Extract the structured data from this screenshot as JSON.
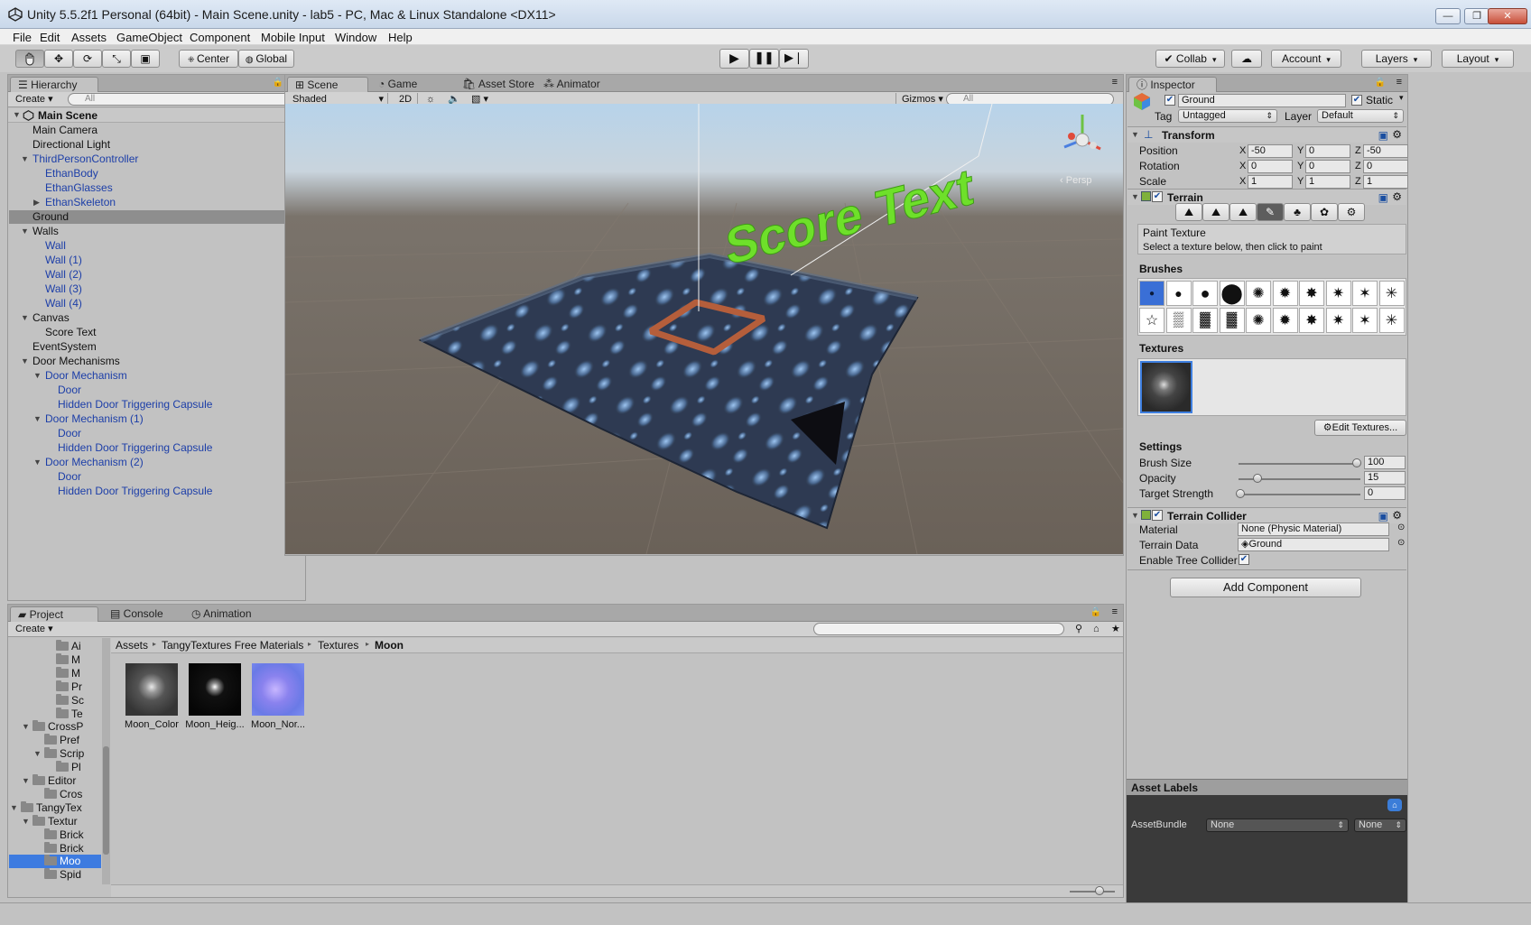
{
  "window": {
    "title": "Unity 5.5.2f1 Personal (64bit) - Main Scene.unity - lab5 - PC, Mac & Linux Standalone <DX11>",
    "min": "—",
    "max": "❐",
    "close": "✕"
  },
  "menu": [
    "File",
    "Edit",
    "Assets",
    "GameObject",
    "Component",
    "Mobile Input",
    "Window",
    "Help"
  ],
  "toolbar": {
    "pivot": "Center",
    "space": "Global",
    "collab": "Collab",
    "account": "Account",
    "layers": "Layers",
    "layout": "Layout"
  },
  "hierarchy": {
    "tab": "Hierarchy",
    "create": "Create",
    "search_placeholder": "All",
    "scene": "Main Scene",
    "items": [
      {
        "label": "Main Camera",
        "indent": 0,
        "blue": false
      },
      {
        "label": "Directional Light",
        "indent": 0,
        "blue": false
      },
      {
        "label": "ThirdPersonController",
        "indent": 0,
        "blue": true,
        "expanded": true
      },
      {
        "label": "EthanBody",
        "indent": 1,
        "blue": true
      },
      {
        "label": "EthanGlasses",
        "indent": 1,
        "blue": true
      },
      {
        "label": "EthanSkeleton",
        "indent": 1,
        "blue": true,
        "collapsed": true
      },
      {
        "label": "Ground",
        "indent": 0,
        "blue": false,
        "selected": true
      },
      {
        "label": "Walls",
        "indent": 0,
        "blue": false,
        "expanded": true
      },
      {
        "label": "Wall",
        "indent": 1,
        "blue": true
      },
      {
        "label": "Wall (1)",
        "indent": 1,
        "blue": true
      },
      {
        "label": "Wall (2)",
        "indent": 1,
        "blue": true
      },
      {
        "label": "Wall (3)",
        "indent": 1,
        "blue": true
      },
      {
        "label": "Wall (4)",
        "indent": 1,
        "blue": true
      },
      {
        "label": "Canvas",
        "indent": 0,
        "blue": false,
        "expanded": true
      },
      {
        "label": "Score Text",
        "indent": 1,
        "blue": false
      },
      {
        "label": "EventSystem",
        "indent": 0,
        "blue": false
      },
      {
        "label": "Door Mechanisms",
        "indent": 0,
        "blue": false,
        "expanded": true
      },
      {
        "label": "Door Mechanism",
        "indent": 1,
        "blue": true,
        "expanded": true
      },
      {
        "label": "Door",
        "indent": 2,
        "blue": true
      },
      {
        "label": "Hidden Door Triggering Capsule",
        "indent": 2,
        "blue": true
      },
      {
        "label": "Door Mechanism (1)",
        "indent": 1,
        "blue": true,
        "expanded": true
      },
      {
        "label": "Door",
        "indent": 2,
        "blue": true
      },
      {
        "label": "Hidden Door Triggering Capsule",
        "indent": 2,
        "blue": true
      },
      {
        "label": "Door Mechanism (2)",
        "indent": 1,
        "blue": true,
        "expanded": true
      },
      {
        "label": "Door",
        "indent": 2,
        "blue": true
      },
      {
        "label": "Hidden Door Triggering Capsule",
        "indent": 2,
        "blue": true
      }
    ]
  },
  "scene": {
    "tabs": [
      "Scene",
      "Game",
      "Asset Store",
      "Animator"
    ],
    "shading": "Shaded",
    "mode2d": "2D",
    "gizmos": "Gizmos",
    "search_placeholder": "All",
    "persp": "Persp",
    "score_text": "Score Text"
  },
  "inspector": {
    "tab": "Inspector",
    "object_name": "Ground",
    "static": "Static",
    "tag_label": "Tag",
    "tag": "Untagged",
    "layer_label": "Layer",
    "layer": "Default",
    "transform": {
      "title": "Transform",
      "position_label": "Position",
      "rotation_label": "Rotation",
      "scale_label": "Scale",
      "position": [
        "-50",
        "0",
        "-50"
      ],
      "rotation": [
        "0",
        "0",
        "0"
      ],
      "scale": [
        "1",
        "1",
        "1"
      ]
    },
    "terrain": {
      "title": "Terrain",
      "tool_title": "Paint Texture",
      "tool_hint": "Select a texture below, then click to paint",
      "brushes_label": "Brushes",
      "textures_label": "Textures",
      "edit_textures": "Edit Textures...",
      "settings_label": "Settings",
      "brush_size_label": "Brush Size",
      "brush_size": "100",
      "opacity_label": "Opacity",
      "opacity": "15",
      "target_strength_label": "Target Strength",
      "target_strength": "0"
    },
    "collider": {
      "title": "Terrain Collider",
      "material_label": "Material",
      "material": "None (Physic Material)",
      "data_label": "Terrain Data",
      "data": "Ground",
      "tree_label": "Enable Tree Collider"
    },
    "add_component": "Add Component",
    "asset_labels": "Asset Labels",
    "asset_bundle": "AssetBundle",
    "bundle_none": "None",
    "variant_none": "None"
  },
  "project": {
    "tabs": [
      "Project",
      "Console",
      "Animation"
    ],
    "create": "Create",
    "breadcrumb": [
      "Assets",
      "TangyTextures Free Materials",
      "Textures",
      "Moon"
    ],
    "tree": [
      {
        "label": "Ai",
        "indent": 3
      },
      {
        "label": "M",
        "indent": 3
      },
      {
        "label": "M",
        "indent": 3
      },
      {
        "label": "Pr",
        "indent": 3
      },
      {
        "label": "Sc",
        "indent": 3
      },
      {
        "label": "Te",
        "indent": 3
      },
      {
        "label": "CrossP",
        "indent": 1,
        "expanded": true
      },
      {
        "label": "Pref",
        "indent": 2
      },
      {
        "label": "Scrip",
        "indent": 2,
        "expanded": true
      },
      {
        "label": "Pl",
        "indent": 3
      },
      {
        "label": "Editor",
        "indent": 1,
        "expanded": true
      },
      {
        "label": "Cros",
        "indent": 2
      },
      {
        "label": "TangyTex",
        "indent": 0,
        "expanded": true
      },
      {
        "label": "Textur",
        "indent": 1,
        "expanded": true
      },
      {
        "label": "Brick",
        "indent": 2
      },
      {
        "label": "Brick",
        "indent": 2
      },
      {
        "label": "Moo",
        "indent": 2,
        "selected": true
      },
      {
        "label": "Spid",
        "indent": 2
      }
    ],
    "assets": [
      "Moon_Color",
      "Moon_Heig...",
      "Moon_Nor..."
    ]
  }
}
